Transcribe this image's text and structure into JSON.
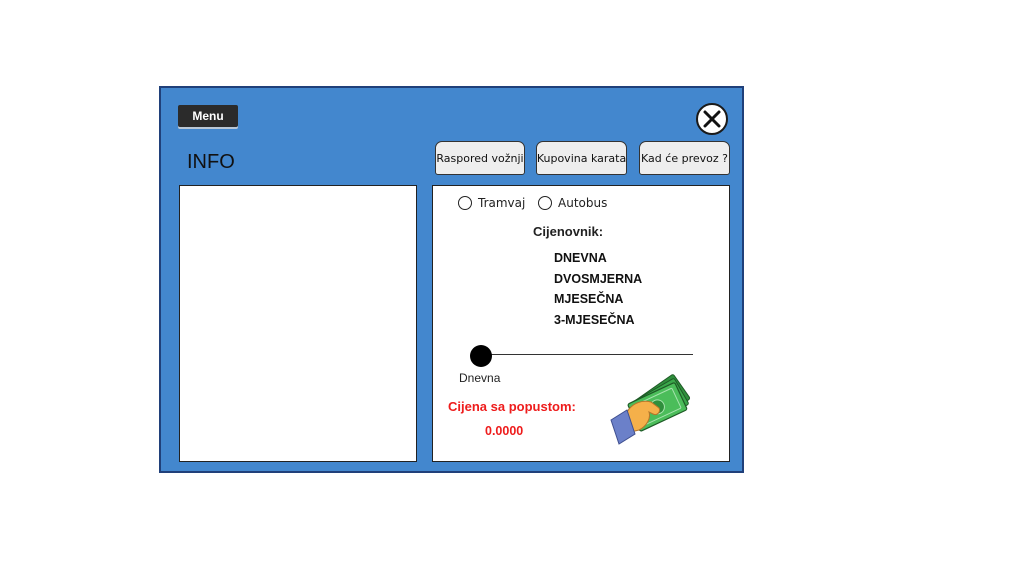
{
  "window": {
    "menu_label": "Menu",
    "info_title": "INFO",
    "tabs": [
      {
        "label": "Raspored vožnji"
      },
      {
        "label": "Kupovina karata"
      },
      {
        "label": "Kad će prevoz ?"
      }
    ]
  },
  "ticket_panel": {
    "transport_options": [
      {
        "label": "Tramvaj",
        "selected": false
      },
      {
        "label": "Autobus",
        "selected": false
      }
    ],
    "pricelist_title": "Cijenovnik:",
    "pricelist_items": [
      "DNEVNA",
      "DVOSMJERNA",
      "MJESEČNA",
      "3-MJESEČNA"
    ],
    "slider": {
      "selected_label": "Dnevna",
      "level": 0
    },
    "discount_label": "Cijena sa popustom:",
    "discount_value": "0.0000"
  },
  "icons": {
    "close": "close-icon",
    "money": "money-payment-icon"
  },
  "colors": {
    "window_bg": "#4387ce",
    "window_border": "#20407a",
    "accent_red": "#ee1c1c",
    "menu_bg": "#2b2b2b",
    "money_green": "#3aa74a",
    "hand_skin": "#f5b04a",
    "sleeve": "#6b80c9"
  }
}
